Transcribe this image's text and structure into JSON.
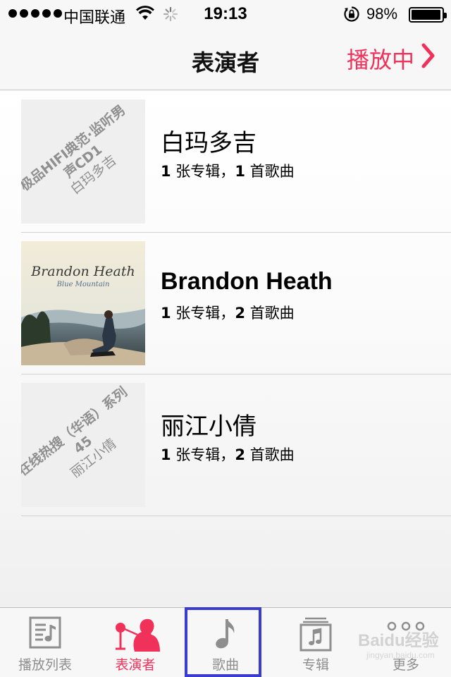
{
  "status_bar": {
    "carrier": "中国联通",
    "time": "19:13",
    "battery_text": "98%",
    "battery_level": 0.98
  },
  "nav": {
    "title": "表演者",
    "now_playing": "播放中",
    "accent_color": "#f0325a"
  },
  "artists": [
    {
      "name": "白玛多吉",
      "albums_count": "1",
      "albums_unit": " 张专辑，",
      "songs_count": "1",
      "songs_unit": " 首歌曲",
      "artwork_title": "极品HIFI典范·监听男声CD1",
      "artwork_artist": "白玛多吉"
    },
    {
      "name": "Brandon Heath",
      "albums_count": "1",
      "albums_unit": " 张专辑，",
      "songs_count": "2",
      "songs_unit": " 首歌曲",
      "artwork_script_title": "Brandon Heath",
      "artwork_script_sub": "Blue Mountain"
    },
    {
      "name": "丽江小倩",
      "albums_count": "1",
      "albums_unit": " 张专辑，",
      "songs_count": "2",
      "songs_unit": " 首歌曲",
      "artwork_title": "在线热搜（华语）系列45",
      "artwork_artist": "丽江小倩"
    }
  ],
  "tabs": [
    {
      "label": "播放列表",
      "icon": "playlist-icon",
      "active": false
    },
    {
      "label": "表演者",
      "icon": "artist-icon",
      "active": true
    },
    {
      "label": "歌曲",
      "icon": "music-note-icon",
      "active": false
    },
    {
      "label": "专辑",
      "icon": "album-icon",
      "active": false
    },
    {
      "label": "更多",
      "icon": "more-icon",
      "active": false
    }
  ],
  "watermark": {
    "text": "Baidu经验",
    "sub": "jingyan.baidu.com"
  }
}
